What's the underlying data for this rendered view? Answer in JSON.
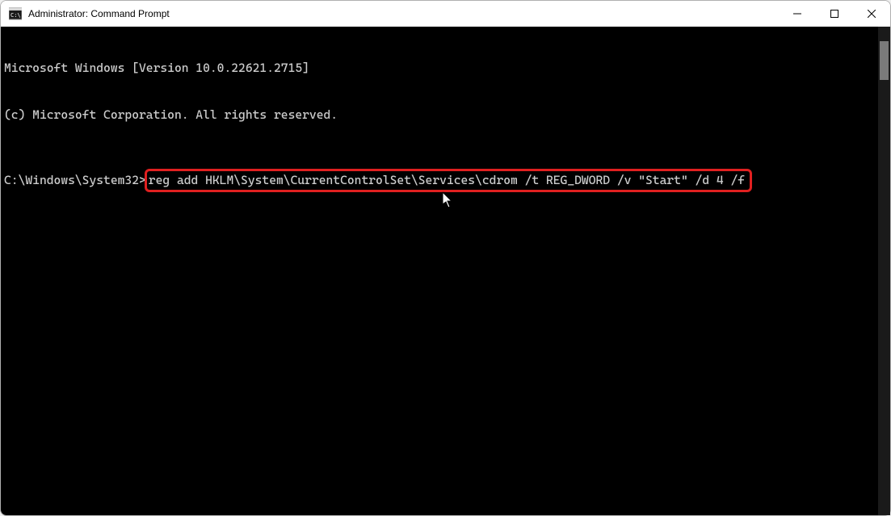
{
  "window": {
    "title": "Administrator: Command Prompt"
  },
  "terminal": {
    "line1": "Microsoft Windows [Version 10.0.22621.2715]",
    "line2": "(c) Microsoft Corporation. All rights reserved.",
    "prompt": "C:\\Windows\\System32>",
    "command": "reg add HKLM\\System\\CurrentControlSet\\Services\\cdrom /t REG_DWORD /v \"Start\" /d 4 /f"
  },
  "colors": {
    "highlight_border": "#e02020",
    "terminal_bg": "#000000",
    "terminal_fg": "#cccccc"
  }
}
